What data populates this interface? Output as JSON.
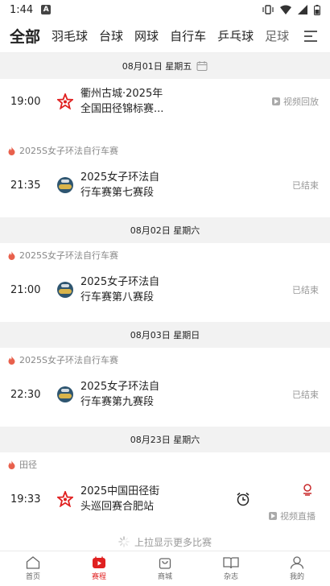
{
  "status_bar": {
    "time": "1:44",
    "notification_icon": "A"
  },
  "tabs": [
    {
      "label": "全部",
      "active": true
    },
    {
      "label": "羽毛球",
      "active": false
    },
    {
      "label": "台球",
      "active": false
    },
    {
      "label": "网球",
      "active": false
    },
    {
      "label": "自行车",
      "active": false
    },
    {
      "label": "乒乓球",
      "active": false
    },
    {
      "label": "足球",
      "active": false
    }
  ],
  "days": [
    {
      "date": "08月01日 星期五",
      "has_calendar_icon": true,
      "groups": [
        {
          "category": "",
          "match": {
            "time": "19:00",
            "title": "衢州古城·2025年\n全国田径锦标赛...",
            "status": "视频回放",
            "logo": "athletics-logo-icon"
          }
        },
        {
          "category": "2025S女子环法自行车赛",
          "match": {
            "time": "21:35",
            "title": "2025女子环法自\n行车赛第七赛段",
            "status": "已结束",
            "logo": "cycling-logo-icon"
          }
        }
      ]
    },
    {
      "date": "08月02日 星期六",
      "groups": [
        {
          "category": "2025S女子环法自行车赛",
          "match": {
            "time": "21:00",
            "title": "2025女子环法自\n行车赛第八赛段",
            "status": "已结束",
            "logo": "cycling-logo-icon"
          }
        }
      ]
    },
    {
      "date": "08月03日 星期日",
      "groups": [
        {
          "category": "2025S女子环法自行车赛",
          "match": {
            "time": "22:30",
            "title": "2025女子环法自\n行车赛第九赛段",
            "status": "已结束",
            "logo": "cycling-logo-icon"
          }
        }
      ]
    },
    {
      "date": "08月23日 星期六",
      "groups": [
        {
          "category": "田径",
          "match": {
            "time": "19:33",
            "title": "2025中国田径街\n头巡回赛合肥站",
            "status": "视频直播",
            "logo": "athletics-logo-icon"
          }
        }
      ]
    }
  ],
  "load_more": "上拉显示更多比赛",
  "bottom_nav": [
    {
      "label": "首页",
      "icon": "home-icon",
      "active": false
    },
    {
      "label": "赛程",
      "icon": "schedule-icon",
      "active": true
    },
    {
      "label": "商城",
      "icon": "shop-icon",
      "active": false
    },
    {
      "label": "杂志",
      "icon": "magazine-icon",
      "active": false
    },
    {
      "label": "我的",
      "icon": "profile-icon",
      "active": false
    }
  ],
  "colors": {
    "accent": "#e02020",
    "muted": "#999999",
    "divider_bg": "#f2f2f2"
  }
}
